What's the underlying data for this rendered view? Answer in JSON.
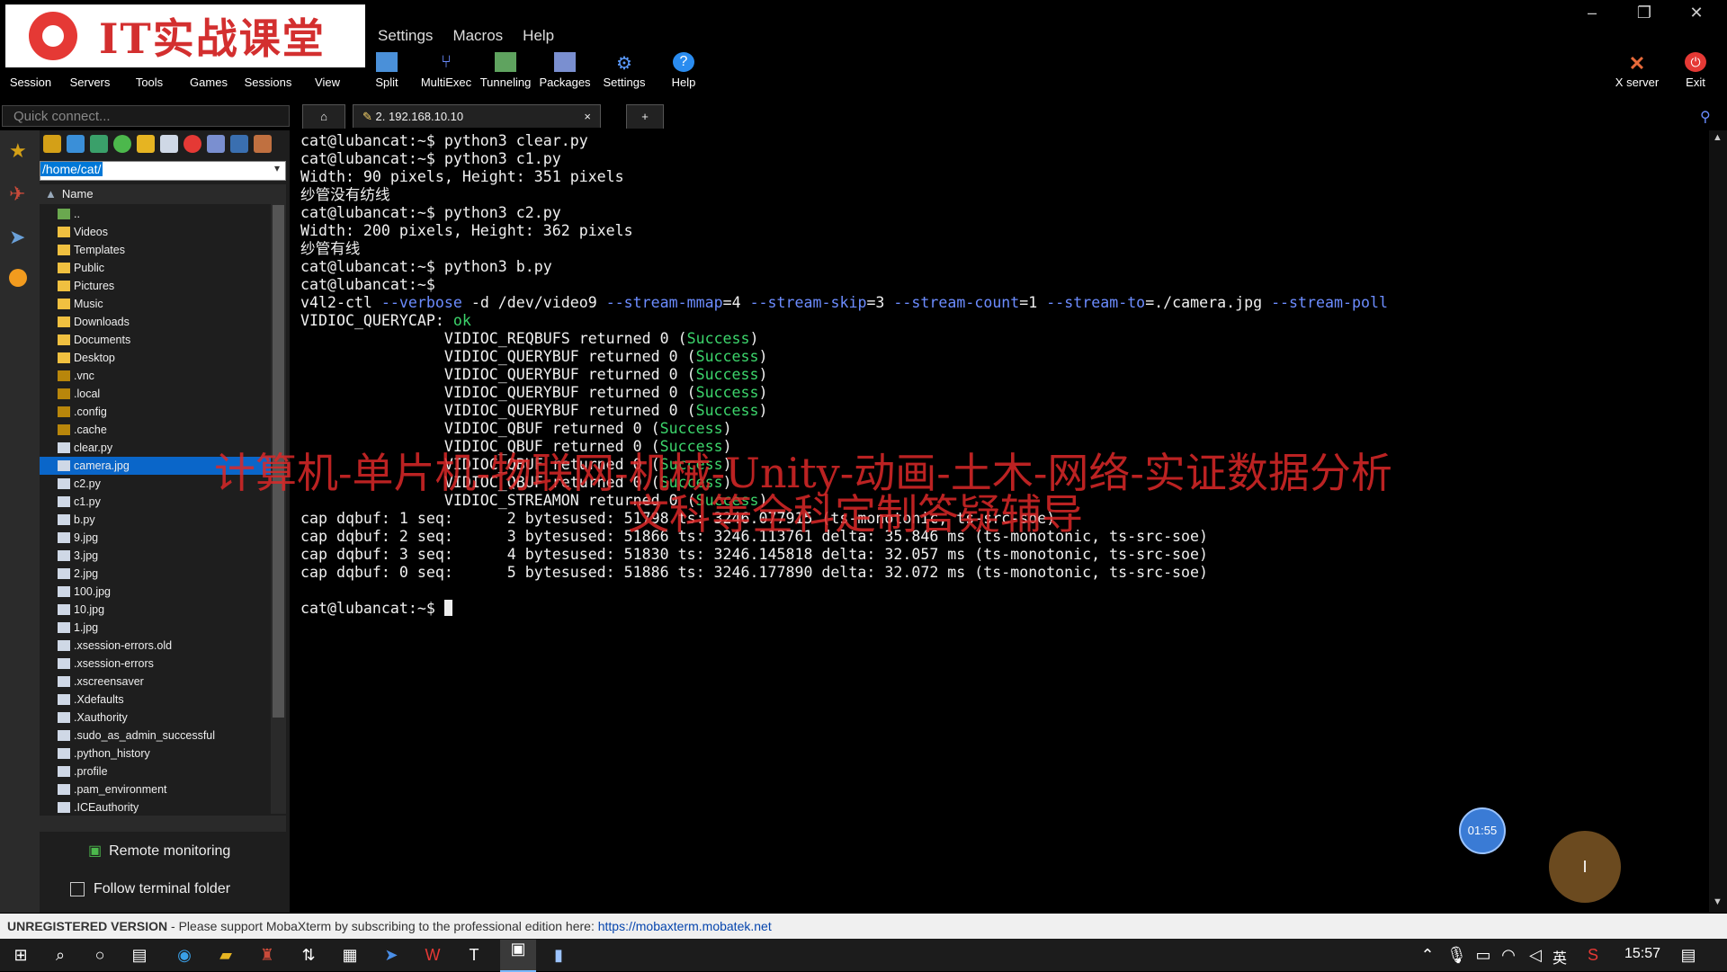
{
  "logo": {
    "text": "IT实战课堂"
  },
  "menu": [
    "Settings",
    "Macros",
    "Help"
  ],
  "toolbar": [
    {
      "label": "Session",
      "icon": "session-icon"
    },
    {
      "label": "Servers",
      "icon": "servers-icon"
    },
    {
      "label": "Tools",
      "icon": "tools-icon"
    },
    {
      "label": "Games",
      "icon": "games-icon"
    },
    {
      "label": "Sessions",
      "icon": "sessions-icon"
    },
    {
      "label": "View",
      "icon": "view-icon"
    },
    {
      "label": "Split",
      "icon": "split-icon"
    },
    {
      "label": "MultiExec",
      "icon": "multiexec-icon"
    },
    {
      "label": "Tunneling",
      "icon": "tunneling-icon"
    },
    {
      "label": "Packages",
      "icon": "packages-icon"
    },
    {
      "label": "Settings",
      "icon": "settings-icon"
    },
    {
      "label": "Help",
      "icon": "help-icon"
    }
  ],
  "right_toolbar": {
    "xserver": "X server",
    "exit": "Exit"
  },
  "quick_connect": {
    "placeholder": "Quick connect..."
  },
  "tabs": {
    "active": "2. 192.168.10.10",
    "close": "×",
    "add": "+"
  },
  "sidebar": {
    "path": "/home/cat/",
    "column_header": "Name",
    "files": [
      "..",
      "Videos",
      "Templates",
      "Public",
      "Pictures",
      "Music",
      "Downloads",
      "Documents",
      "Desktop",
      ".vnc",
      ".local",
      ".config",
      ".cache",
      "clear.py",
      "camera.jpg",
      "c2.py",
      "c1.py",
      "b.py",
      "9.jpg",
      "3.jpg",
      "2.jpg",
      "100.jpg",
      "10.jpg",
      "1.jpg",
      ".xsession-errors.old",
      ".xsession-errors",
      ".xscreensaver",
      ".Xdefaults",
      ".Xauthority",
      ".sudo_as_admin_successful",
      ".python_history",
      ".profile",
      ".pam_environment",
      ".ICEauthority"
    ],
    "selected_file": "camera.jpg",
    "remote_monitoring": "Remote monitoring",
    "follow_terminal": "Follow terminal folder"
  },
  "terminal": {
    "prompt": "cat@lubancat:~$",
    "lines": [
      "cat@lubancat:~$ python3 clear.py",
      "cat@lubancat:~$ python3 c1.py",
      "Width: 90 pixels, Height: 351 pixels",
      "纱管没有纺线",
      "cat@lubancat:~$ python3 c2.py",
      "Width: 200 pixels, Height: 362 pixels",
      "纱管有线",
      "cat@lubancat:~$ python3 b.py",
      "cat@lubancat:~$"
    ],
    "v4l2_cmd": "v4l2-ctl --verbose -d /dev/video9 --stream-mmap=4 --stream-skip=3 --stream-count=1 --stream-to=./camera.jpg --stream-poll",
    "querycap": "VIDIOC_QUERYCAP: ok",
    "ioctl_lines": [
      "VIDIOC_REQBUFS returned 0 (Success)",
      "VIDIOC_QUERYBUF returned 0 (Success)",
      "VIDIOC_QUERYBUF returned 0 (Success)",
      "VIDIOC_QUERYBUF returned 0 (Success)",
      "VIDIOC_QUERYBUF returned 0 (Success)",
      "VIDIOC_QBUF returned 0 (Success)",
      "VIDIOC_QBUF returned 0 (Success)",
      "VIDIOC_QBUF returned 0 (Success)",
      "VIDIOC_QBUF returned 0 (Success)",
      "VIDIOC_STREAMON returned 0 (Success)"
    ],
    "dqbuf_lines": [
      "cap dqbuf: 1 seq:      2 bytesused: 51798 ts: 3246.077915 (ts-monotonic, ts-src-soe)",
      "cap dqbuf: 2 seq:      3 bytesused: 51866 ts: 3246.113761 delta: 35.846 ms (ts-monotonic, ts-src-soe)",
      "cap dqbuf: 3 seq:      4 bytesused: 51830 ts: 3246.145818 delta: 32.057 ms (ts-monotonic, ts-src-soe)",
      "cap dqbuf: 0 seq:      5 bytesused: 51886 ts: 3246.177890 delta: 32.072 ms (ts-monotonic, ts-src-soe)"
    ]
  },
  "watermark": {
    "line1": "计算机-单片机-物联网-机械-Unity-动画-土木-网络-实证数据分析",
    "line2": "文科等全科定制答疑辅导"
  },
  "overlay": {
    "timer": "01:55",
    "cursor_glyph": "I"
  },
  "status_bar": {
    "unregistered": "UNREGISTERED VERSION",
    "message": " -  Please support MobaXterm by subscribing to the professional edition here: ",
    "link": "https://mobaxterm.mobatek.net"
  },
  "taskbar": {
    "ime": "英",
    "time": "15:57"
  },
  "colors": {
    "success_green": "#3cd46b",
    "option_blue": "#6c8cff",
    "selection_blue": "#0a66c9",
    "watermark_red": "#dc2828"
  }
}
